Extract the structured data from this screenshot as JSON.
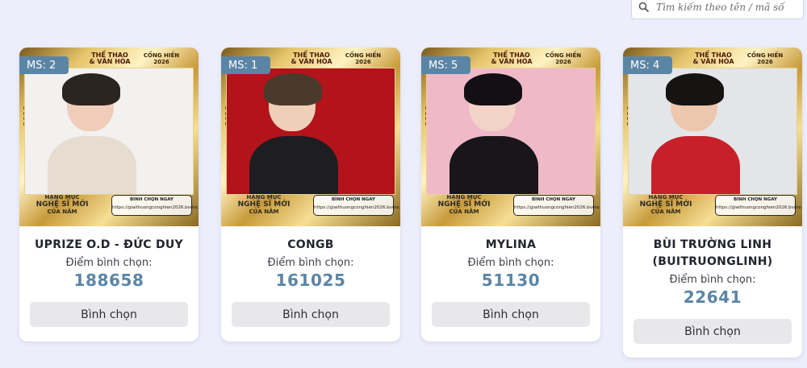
{
  "search": {
    "placeholder": "Tìm kiếm theo tên / mã số",
    "icon": "search-icon"
  },
  "poster_text": {
    "year": "2026",
    "logo_a": "THỂ THAO & VĂN HÓA",
    "logo_b": "CỐNG HIẾN 2026",
    "category_1": "HẠNG MỤC",
    "category_2": "NGHỆ SĨ MỚI",
    "category_3": "CỦA NĂM",
    "vote_now": "BÌNH CHỌN NGAY",
    "vote_url": "https://giaithuongconghien2026.bvote.vn/"
  },
  "cards": [
    {
      "ms": "MS: 2",
      "name": "UPRIZE O.D - ĐỨC DUY",
      "score_label": "Điểm bình chọn:",
      "score": "188658",
      "button": "Bình chọn"
    },
    {
      "ms": "MS: 1",
      "name": "CONGB",
      "score_label": "Điểm bình chọn:",
      "score": "161025",
      "button": "Bình chọn"
    },
    {
      "ms": "MS: 5",
      "name": "MYLINA",
      "score_label": "Điểm bình chọn:",
      "score": "51130",
      "button": "Bình chọn"
    },
    {
      "ms": "MS: 4",
      "name": "BÙI TRƯỜNG LINH (BUITRUONGLINH)",
      "score_label": "Điểm bình chọn:",
      "score": "22641",
      "button": "Bình chọn"
    }
  ],
  "colors": {
    "accent": "#5b85a5",
    "background": "#eceefb",
    "button_bg": "#e8e8ea"
  }
}
